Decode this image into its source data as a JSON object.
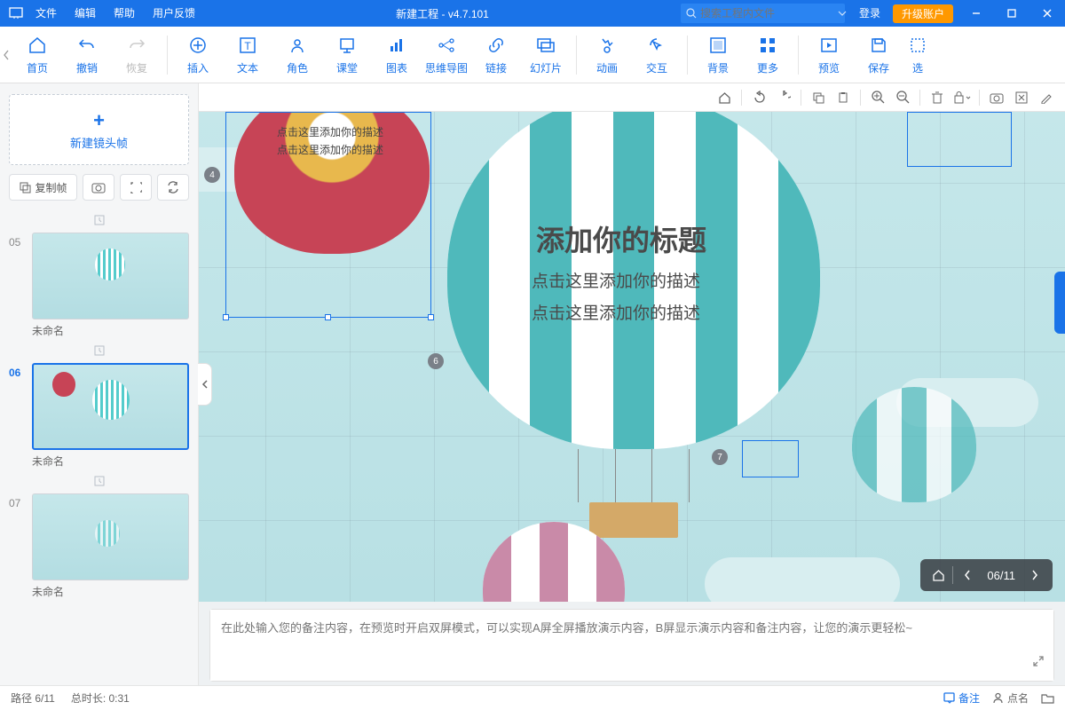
{
  "titlebar": {
    "menus": [
      "文件",
      "编辑",
      "帮助",
      "用户反馈"
    ],
    "title": "新建工程 - v4.7.101",
    "search_placeholder": "搜索工程内文件",
    "login": "登录",
    "upgrade": "升级账户"
  },
  "toolbar": {
    "home": "首页",
    "undo": "撤销",
    "redo": "恢复",
    "insert": "插入",
    "text": "文本",
    "role": "角色",
    "class": "课堂",
    "chart": "图表",
    "mindmap": "思维导图",
    "link": "链接",
    "slide": "幻灯片",
    "anim": "动画",
    "interact": "交互",
    "bg": "背景",
    "more": "更多",
    "preview": "预览",
    "save": "保存",
    "select": "选"
  },
  "side": {
    "newframe": "新建镜头帧",
    "copyframe": "复制帧",
    "thumbs": [
      {
        "num": "05",
        "title": "未命名"
      },
      {
        "num": "06",
        "title": "未命名",
        "selected": true
      },
      {
        "num": "07",
        "title": "未命名"
      }
    ]
  },
  "canvas": {
    "small_desc1": "点击这里添加你的描述",
    "small_desc2": "点击这里添加你的描述",
    "title": "添加你的标题",
    "desc1": "点击这里添加你的描述",
    "desc2": "点击这里添加你的描述",
    "marker4": "4",
    "marker6": "6",
    "marker7": "7",
    "nav": "06/11"
  },
  "notes": {
    "placeholder": "在此处输入您的备注内容，在预览时开启双屏模式，可以实现A屏全屏播放演示内容，B屏显示演示内容和备注内容，让您的演示更轻松~"
  },
  "status": {
    "path": "路径 6/11",
    "duration": "总时长: 0:31",
    "remark": "备注",
    "dianming": "点名"
  }
}
